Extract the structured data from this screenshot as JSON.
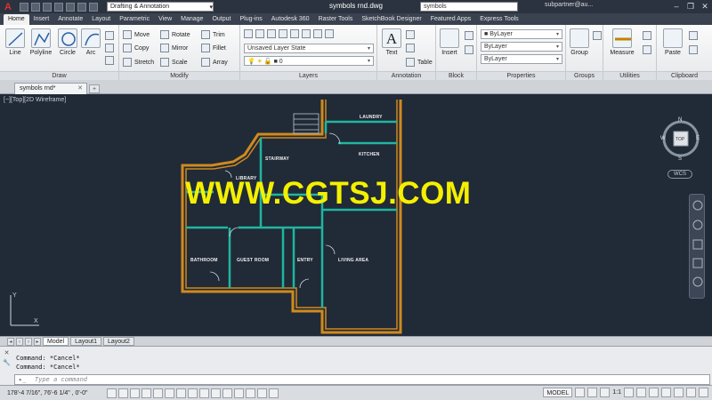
{
  "title_bar": {
    "workspace": "Drafting & Annotation",
    "document_title": "symbols rnd.dwg",
    "search_value": "symbols",
    "user": "subpartner@au..."
  },
  "ribbon_tabs": [
    "Home",
    "Insert",
    "Annotate",
    "Layout",
    "Parametric",
    "View",
    "Manage",
    "Output",
    "Plug-ins",
    "Autodesk 360",
    "Raster Tools",
    "SketchBook Designer",
    "Featured Apps",
    "Express Tools"
  ],
  "ribbon": {
    "draw": {
      "title": "Draw",
      "line": "Line",
      "polyline": "Polyline",
      "circle": "Circle",
      "arc": "Arc"
    },
    "modify": {
      "title": "Modify",
      "move": "Move",
      "rotate": "Rotate",
      "trim": "Trim",
      "copy": "Copy",
      "mirror": "Mirror",
      "fillet": "Fillet",
      "stretch": "Stretch",
      "scale": "Scale",
      "array": "Array"
    },
    "layers": {
      "title": "Layers",
      "layer_state": "Unsaved Layer State",
      "current_layer": "0"
    },
    "annotation": {
      "title": "Annotation",
      "text": "Text",
      "table": "Table"
    },
    "block": {
      "title": "Block",
      "insert": "Insert"
    },
    "properties": {
      "title": "Properties",
      "color": "ByLayer",
      "linetype": "ByLayer",
      "lineweight": "ByLayer"
    },
    "groups": {
      "title": "Groups",
      "group": "Group"
    },
    "utilities": {
      "title": "Utilities",
      "measure": "Measure"
    },
    "clipboard": {
      "title": "Clipboard",
      "paste": "Paste"
    }
  },
  "doc_tab": {
    "name": "symbols rnd*"
  },
  "viewport": {
    "label": "[−][Top][2D Wireframe]",
    "watermark": "WWW.CGTSJ.COM",
    "rooms": [
      "LAUNDRY",
      "KITCHEN",
      "STAIRWAY",
      "LIBRARY",
      "BATHROOM",
      "GUEST ROOM",
      "ENTRY",
      "LIVING AREA"
    ],
    "compass": {
      "n": "N",
      "s": "S",
      "e": "E",
      "w": "W",
      "top": "TOP"
    },
    "wcs": "WCS"
  },
  "layout_tabs": [
    "Model",
    "Layout1",
    "Layout2"
  ],
  "command": {
    "history": [
      "Command: *Cancel*",
      "Command: *Cancel*"
    ],
    "placeholder": "Type a command"
  },
  "status_bar": {
    "coords": "178'-4 7/16\", 76'-6 1/4\" , 0'-0\"",
    "space": "MODEL",
    "scale": "1:1"
  },
  "colors": {
    "wall": "#d08a1e",
    "partition": "#1fb6a0",
    "canvas": "#212a37",
    "watermark": "#f4f000"
  }
}
